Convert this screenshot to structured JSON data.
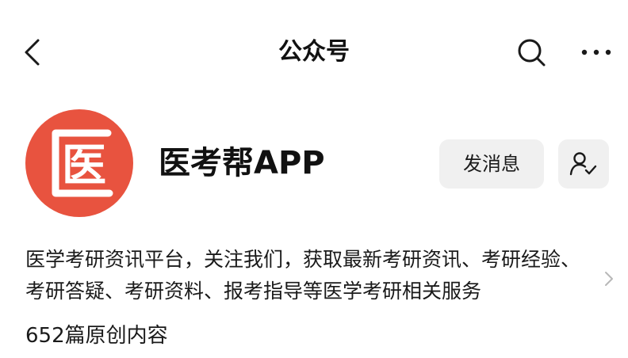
{
  "nav": {
    "title": "公众号",
    "back_icon": "chevron-left-icon",
    "search_icon": "search-icon",
    "more_icon": "ellipsis-icon"
  },
  "account": {
    "avatar_char": "医",
    "avatar_color": "#e8533f",
    "name": "医考帮APP",
    "message_label": "发消息",
    "follow_icon": "user-check-icon",
    "description": "医学考研资讯平台，关注我们，获取最新考研资讯、考研经验、考研答疑、考研资料、报考指导等医学考研相关服务",
    "article_count": "652篇原创内容"
  }
}
